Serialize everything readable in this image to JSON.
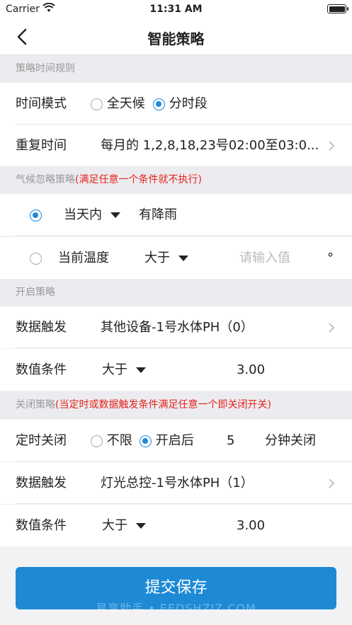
{
  "status_bar": {
    "carrier": "Carrier",
    "time": "11:31 AM"
  },
  "nav": {
    "title": "智能策略"
  },
  "sections": {
    "time_rule": {
      "title": "策略时间规则"
    },
    "climate": {
      "title": "气候忽略策略",
      "note": "(满足任意一个条件就不执行)"
    },
    "open": {
      "title": "开启策略"
    },
    "close": {
      "title": "关闭策略",
      "note": "(当定时或数据触发条件满足任意一个即关闭开关)"
    }
  },
  "time_mode": {
    "label": "时间模式",
    "options": [
      "全天候",
      "分时段"
    ],
    "selected": "分时段"
  },
  "repeat_time": {
    "label": "重复时间",
    "value": "每月的 1,2,8,18,23号02:00至03:0..."
  },
  "climate_rows": {
    "row1": {
      "selected": true,
      "scope": "当天内",
      "condition": "有降雨"
    },
    "row2": {
      "selected": false,
      "label": "当前温度",
      "op": "大于",
      "placeholder": "请输入值",
      "unit": "°"
    }
  },
  "open_strategy": {
    "trigger": {
      "label": "数据触发",
      "value": "其他设备-1号水体PH（0）"
    },
    "condition": {
      "label": "数值条件",
      "op": "大于",
      "value": "3.00"
    }
  },
  "close_strategy": {
    "timer": {
      "label": "定时关闭",
      "options": [
        "不限",
        "开启后"
      ],
      "selected": "开启后",
      "minutes": "5",
      "suffix": "分钟关闭"
    },
    "trigger": {
      "label": "数据触发",
      "value": "灯光总控-1号水体PH（1）"
    },
    "condition": {
      "label": "数值条件",
      "op": "大于",
      "value": "3.00"
    }
  },
  "submit": {
    "label": "提交保存"
  },
  "watermark": "易享助手 • EEDSHZIZ.COM",
  "colors": {
    "accent": "#1e8ad6",
    "warning": "#e5231c"
  }
}
